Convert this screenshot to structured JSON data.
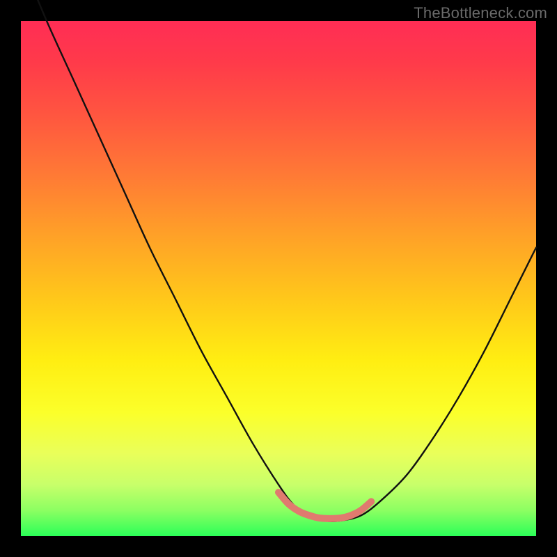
{
  "watermark": "TheBottleneck.com",
  "colors": {
    "background": "#000000",
    "curve": "#111111",
    "highlight": "#e07a6f",
    "gradient_top": "#ff2d55",
    "gradient_bottom": "#2bff58"
  },
  "chart_data": {
    "type": "line",
    "title": "",
    "xlabel": "",
    "ylabel": "",
    "xlim": [
      0,
      1
    ],
    "ylim": [
      0,
      1
    ],
    "series": [
      {
        "name": "bottleneck-curve",
        "type": "line",
        "x": [
          0.0,
          0.05,
          0.1,
          0.15,
          0.2,
          0.25,
          0.3,
          0.35,
          0.4,
          0.45,
          0.5,
          0.53,
          0.56,
          0.59,
          0.62,
          0.66,
          0.7,
          0.75,
          0.8,
          0.85,
          0.9,
          0.95,
          1.0
        ],
        "values": [
          1.12,
          1.0,
          0.89,
          0.78,
          0.67,
          0.56,
          0.46,
          0.36,
          0.27,
          0.18,
          0.1,
          0.06,
          0.04,
          0.03,
          0.03,
          0.04,
          0.07,
          0.12,
          0.19,
          0.27,
          0.36,
          0.46,
          0.56
        ]
      },
      {
        "name": "highlight-segment",
        "type": "line",
        "x": [
          0.5,
          0.52,
          0.54,
          0.56,
          0.58,
          0.6,
          0.62,
          0.64,
          0.66,
          0.68
        ],
        "values": [
          0.085,
          0.062,
          0.048,
          0.04,
          0.035,
          0.034,
          0.035,
          0.04,
          0.05,
          0.067
        ]
      }
    ]
  }
}
